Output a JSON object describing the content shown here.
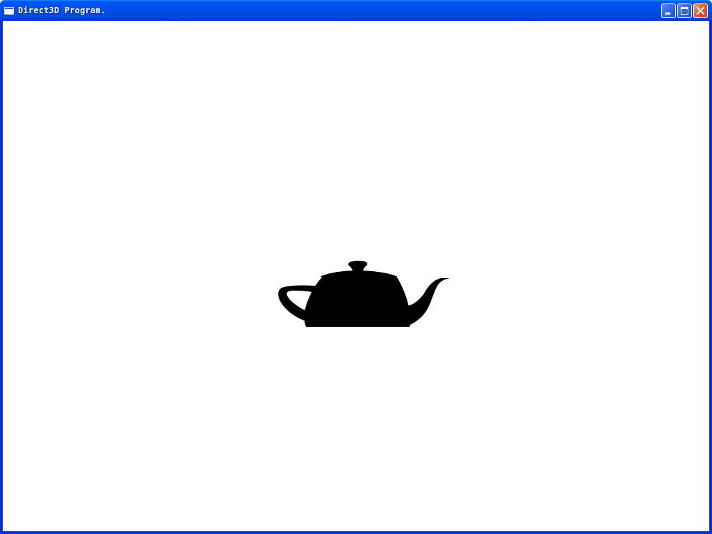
{
  "window": {
    "title": "Direct3D Program.",
    "controls": {
      "minimize": "minimize",
      "maximize": "maximize",
      "close": "close"
    },
    "colors": {
      "titlebar": "#0053ee",
      "frame": "#0831d9",
      "close_button": "#e0582f",
      "client_background": "#ffffff"
    }
  },
  "scene": {
    "object": "teapot-icon",
    "color": "#000000"
  }
}
